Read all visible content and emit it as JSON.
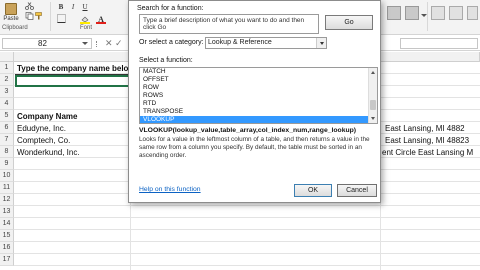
{
  "ribbon": {
    "paste_label": "Paste",
    "clipboard_label": "Clipboard",
    "font_label": "Font",
    "bold_label": "B",
    "italic_label": "I",
    "underline_label": "U",
    "fill_color": "#ffeb00",
    "font_color": "#e0201b"
  },
  "formula_bar": {
    "name_box": "82",
    "cancel_icon": "✕",
    "enter_icon": "✓"
  },
  "sheet": {
    "row_numbers": [
      "1",
      "2",
      "3",
      "4",
      "5",
      "6",
      "7",
      "8",
      "9",
      "10",
      "11",
      "12",
      "13",
      "14",
      "15",
      "16",
      "17"
    ],
    "cells": {
      "a1": "Type the company name belo",
      "a5": "Company Name",
      "a6": "Edudyne, Inc.",
      "a7": "Comptech, Co.",
      "a8": "Wonderkund, Inc.",
      "d6": "East Lansing, MI 4882",
      "d7": "East Lansing, MI 48823",
      "d8": "ent Circle East Lansing M"
    }
  },
  "dialog": {
    "search_label": "Search for a function:",
    "search_text": "Type a brief description of what you want to do and then click Go",
    "go_label": "Go",
    "category_label": "Or select a category:",
    "category_value": "Lookup & Reference",
    "select_label": "Select a function:",
    "functions": [
      "MATCH",
      "OFFSET",
      "ROW",
      "ROWS",
      "RTD",
      "TRANSPOSE",
      "VLOOKUP"
    ],
    "selected_function": "VLOOKUP",
    "syntax": "VLOOKUP(lookup_value,table_array,col_index_num,range_lookup)",
    "description": "Looks for a value in the leftmost column of a table, and then returns a value in the same row from a column you specify. By default, the table must be sorted in an ascending order.",
    "help_link": "Help on this function",
    "ok_label": "OK",
    "cancel_label": "Cancel",
    "selection_color": "#3399ff",
    "link_color": "#0b62c4"
  },
  "accent_color": "#217346"
}
